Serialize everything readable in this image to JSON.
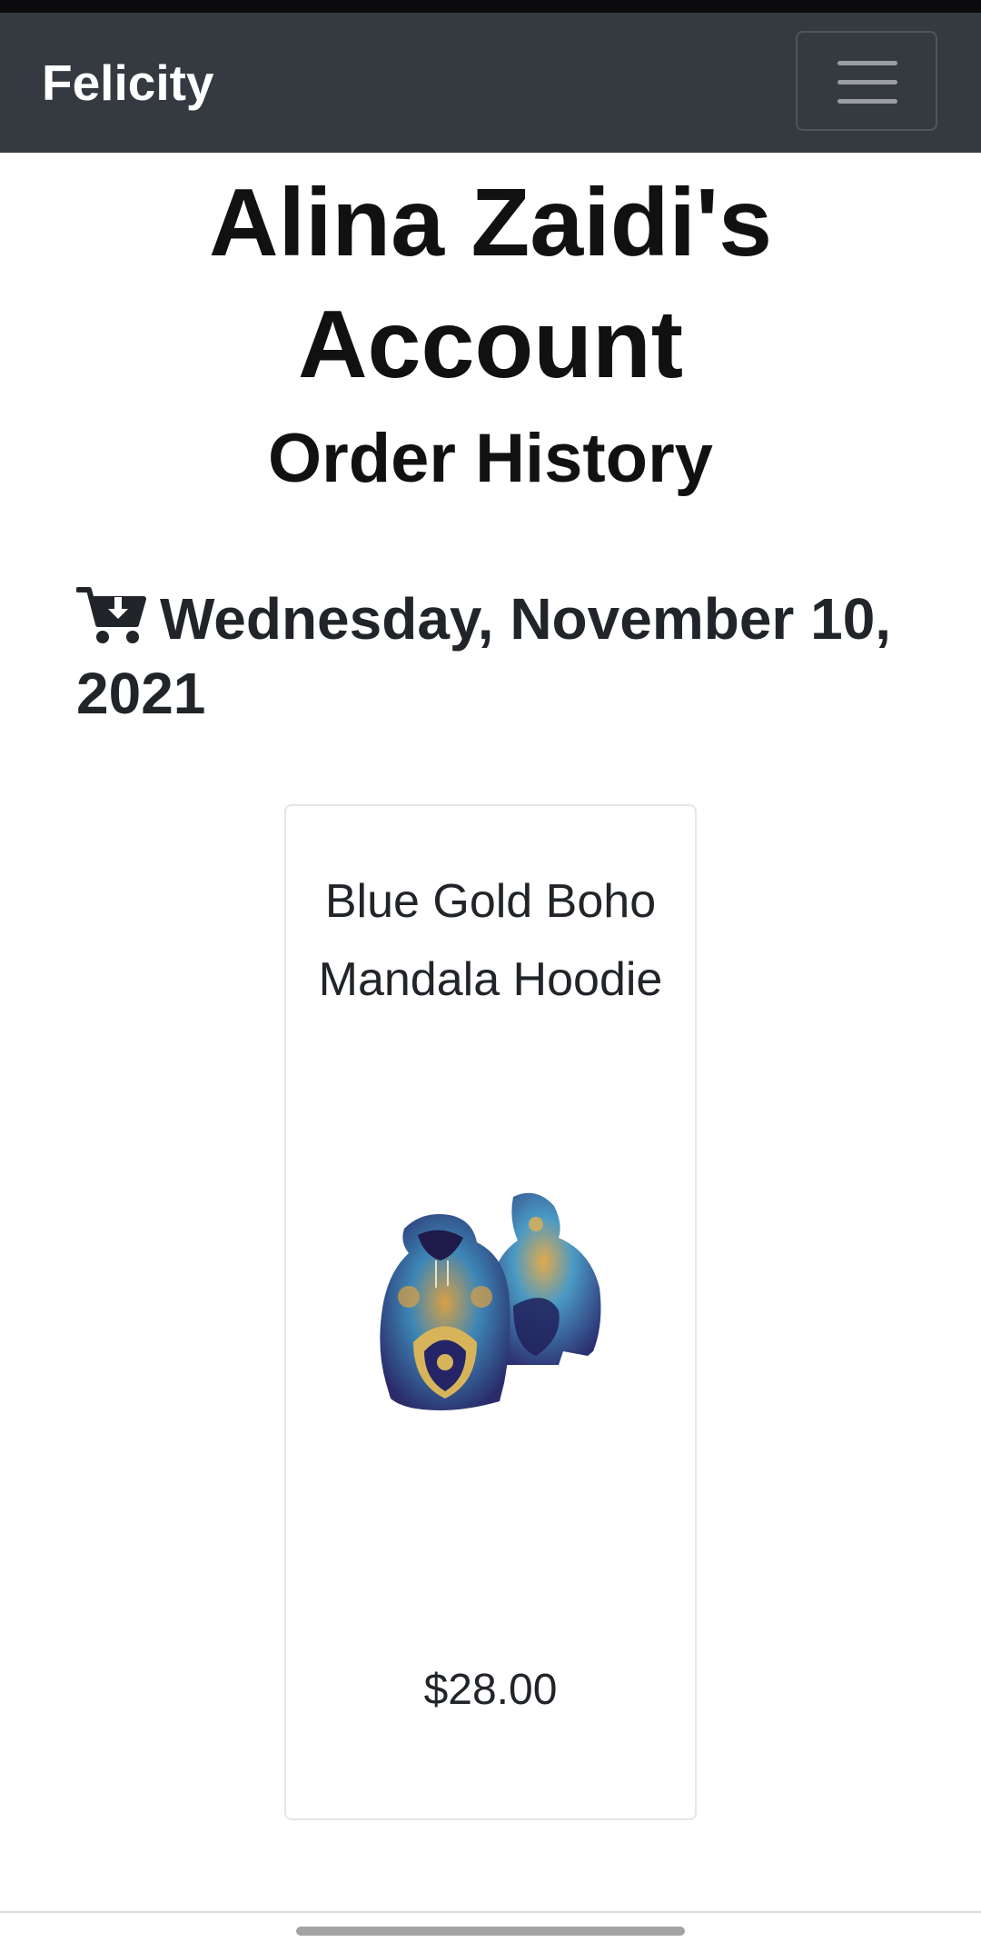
{
  "navbar": {
    "brand": "Felicity",
    "menu_icon": "hamburger-menu-icon"
  },
  "page": {
    "title": "Alina Zaidi's Account",
    "subtitle": "Order History"
  },
  "orders": [
    {
      "icon": "cart-download-icon",
      "date": "Wednesday, November 10, 2021",
      "items": [
        {
          "name": "Blue Gold Boho Mandala Hoodie",
          "price": "$28.00"
        }
      ]
    }
  ],
  "colors": {
    "navbar_bg": "#343a40",
    "brand_text": "#ffffff",
    "text": "#212529",
    "card_border": "#e6e6e6"
  }
}
